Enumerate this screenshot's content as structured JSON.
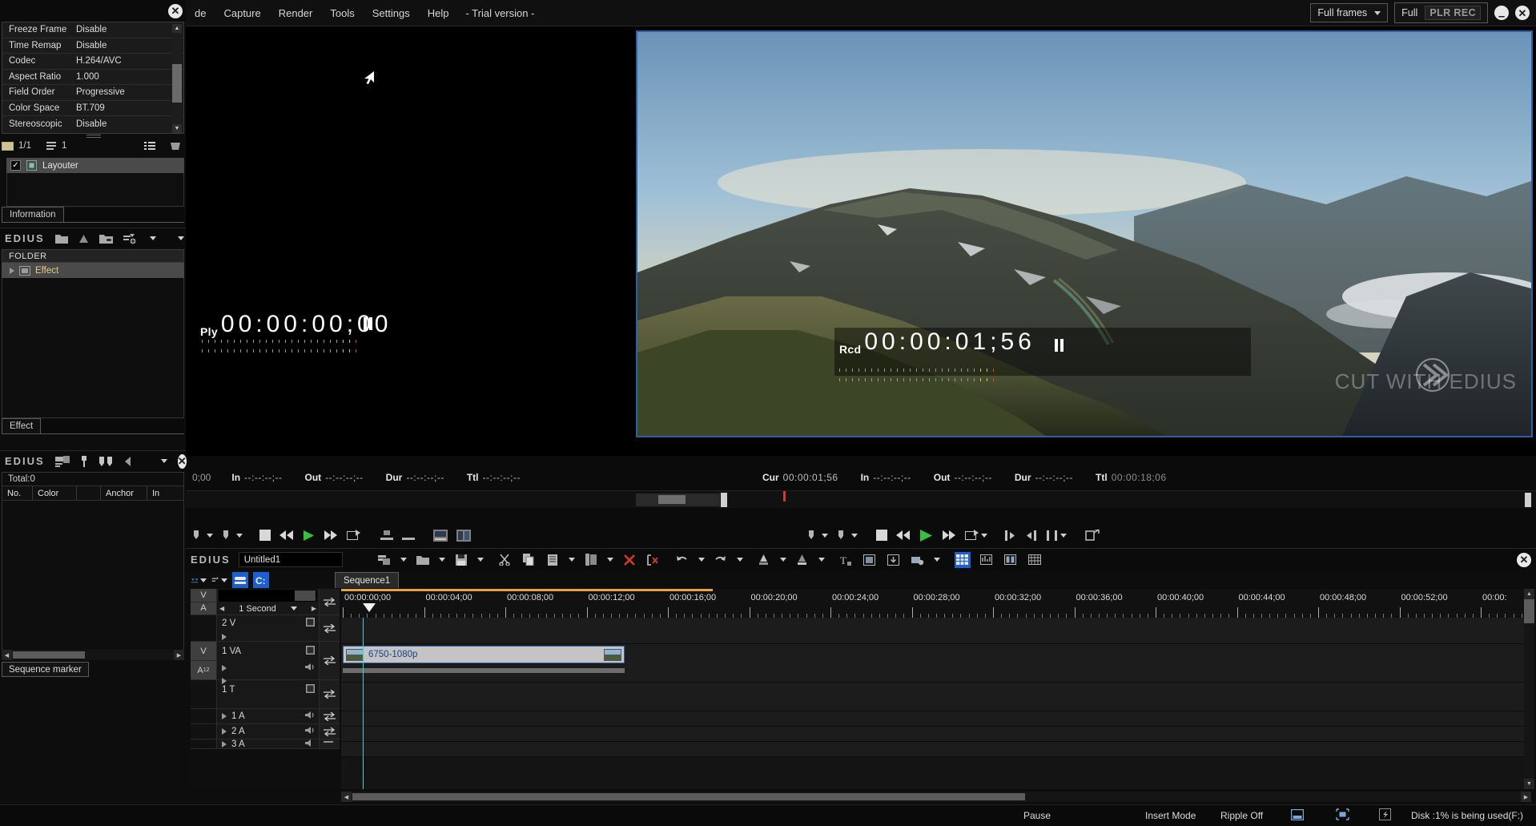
{
  "menu": {
    "items": [
      "de",
      "Capture",
      "Render",
      "Tools",
      "Settings",
      "Help"
    ],
    "trial": "- Trial version -"
  },
  "topright": {
    "quality_select": "Full frames",
    "full_label": "Full",
    "rec_label": "PLR REC",
    "minimize": "–",
    "close": "✕"
  },
  "information": {
    "properties": [
      {
        "key": "Freeze Frame",
        "value": "Disable"
      },
      {
        "key": "Time Remap",
        "value": "Disable"
      },
      {
        "key": "Codec",
        "value": "H.264/AVC"
      },
      {
        "key": "Aspect Ratio",
        "value": "1.000"
      },
      {
        "key": "Field Order",
        "value": "Progressive"
      },
      {
        "key": "Color Space",
        "value": "BT.709"
      },
      {
        "key": "Stereoscopic",
        "value": "Disable"
      }
    ],
    "clip_count": "1/1",
    "filter_count": "1",
    "layouter_label": "Layouter",
    "tab_label": "Information"
  },
  "effect_palette": {
    "logo": "EDIUS",
    "folder_header": "FOLDER",
    "root_item": "Effect",
    "tab_label": "Effect"
  },
  "marker_palette": {
    "logo": "EDIUS",
    "total": "Total:0",
    "columns": [
      "No.",
      "Color",
      "",
      "Anchor",
      "In"
    ],
    "tab_label": "Sequence marker"
  },
  "player": {
    "label": "Ply",
    "timecode": "00:00:00;00",
    "state_icon": "pause-icon",
    "info": {
      "cur": "0;00",
      "in_label": "In",
      "in_value": "--:--:--;--",
      "out_label": "Out",
      "out_value": "--:--:--;--",
      "dur_label": "Dur",
      "dur_value": "--:--:--;--",
      "ttl_label": "Ttl",
      "ttl_value": "--:--:--;--"
    }
  },
  "recorder": {
    "label": "Rcd",
    "timecode": "00:00:01;56",
    "state_icon": "pause-icon",
    "watermark": "CUT WITH EDIUS",
    "info": {
      "cur_label": "Cur",
      "cur_value": "00:00:01;56",
      "in_label": "In",
      "in_value": "--:--:--;--",
      "out_label": "Out",
      "out_value": "--:--:--;--",
      "dur_label": "Dur",
      "dur_value": "--:--:--;--",
      "ttl_label": "Ttl",
      "ttl_value": "00:00:18;06"
    }
  },
  "timeline": {
    "logo": "EDIUS",
    "project_name": "Untitled1",
    "sequence_tab": "Sequence1",
    "zoom_select": "1 Second",
    "tracks": [
      {
        "id": "track-2v",
        "name": "2 V",
        "type": "video"
      },
      {
        "id": "track-1va",
        "name": "1 VA",
        "type": "videoaudio"
      },
      {
        "id": "track-1t",
        "name": "1 T",
        "type": "title"
      },
      {
        "id": "track-1a",
        "name": "1 A",
        "type": "audio"
      },
      {
        "id": "track-2a",
        "name": "2 A",
        "type": "audio"
      },
      {
        "id": "track-3a",
        "name": "3 A",
        "type": "audio"
      }
    ],
    "sync_labels": {
      "v": "V",
      "a": "A",
      "a12": "A"
    },
    "ruler_labels": [
      "00:00:00;00",
      "00:00:04;00",
      "00:00:08;00",
      "00:00:12;00",
      "00:00:16;00",
      "00:00:20;00",
      "00:00:24;00",
      "00:00:28;00",
      "00:00:32;00",
      "00:00:36;00",
      "00:00:40;00",
      "00:00:44;00",
      "00:00:48;00",
      "00:00:52;00",
      "00:00:"
    ],
    "clip": {
      "name": "6750-1080p"
    }
  },
  "statusbar": {
    "pause": "Pause",
    "insert_mode": "Insert Mode",
    "ripple": "Ripple Off",
    "disk": "Disk :1% is being used(F:)"
  },
  "colors": {
    "accent_blue": "#1e5fd0",
    "clip_border": "#2c5fa8",
    "clip_body": "#c4c4c4",
    "ruler_orange": "#e8a33d",
    "playhead_cyan": "#2fd8d8",
    "play_green": "#34c23a",
    "red": "#d33a2c"
  }
}
